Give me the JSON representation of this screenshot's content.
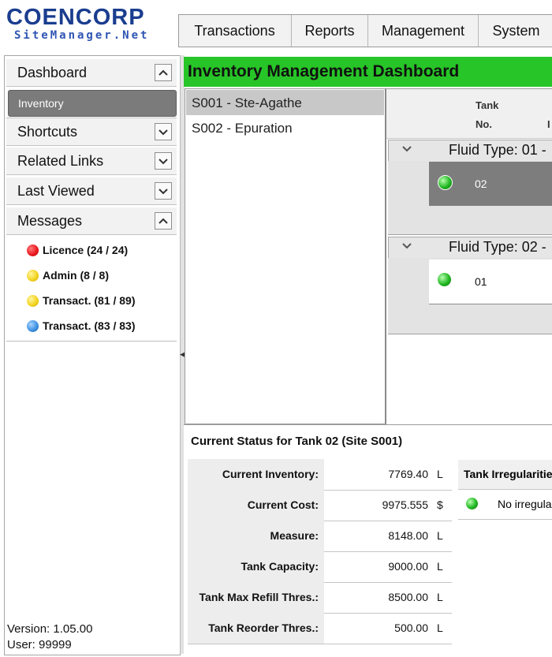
{
  "logo": {
    "line1": "COENCORP",
    "line2": "SiteManager.Net"
  },
  "menu": [
    "Transactions",
    "Reports",
    "Management",
    "System"
  ],
  "sidebar": {
    "dashboard": "Dashboard",
    "inventory": "Inventory",
    "shortcuts": "Shortcuts",
    "related_links": "Related Links",
    "last_viewed": "Last Viewed",
    "messages": "Messages",
    "message_items": [
      {
        "label": "Licence (24 / 24)",
        "color": "#e8141a"
      },
      {
        "label": "Admin (8 / 8)",
        "color": "#f2d21a"
      },
      {
        "label": "Transact. (81 / 89)",
        "color": "#f2d21a"
      },
      {
        "label": "Transact. (83 / 83)",
        "color": "#3a8ee0"
      }
    ],
    "version": "Version: 1.05.00",
    "user": "User: 99999"
  },
  "main": {
    "title": "Inventory Management Dashboard",
    "title_bg": "#27c527",
    "sites": [
      "S001 - Ste-Agathe",
      "S002 - Epuration"
    ],
    "grid_header": {
      "tank": "Tank",
      "no": "No.",
      "extra": "I"
    },
    "groups": [
      {
        "title": "Fluid Type: 01 -",
        "tank": "02",
        "status_color": "#22b822"
      },
      {
        "title": "Fluid Type: 02 -",
        "tank": "01",
        "status_color": "#22b822"
      }
    ]
  },
  "status": {
    "title": "Current Status for Tank 02 (Site S001)",
    "rows": [
      {
        "label": "Current Inventory:",
        "value": "7769.40",
        "unit": "L"
      },
      {
        "label": "Current Cost:",
        "value": "9975.555",
        "unit": "$"
      },
      {
        "label": "Measure:",
        "value": "8148.00",
        "unit": "L"
      },
      {
        "label": "Tank Capacity:",
        "value": "9000.00",
        "unit": "L"
      },
      {
        "label": "Tank Max Refill Thres.:",
        "value": "8500.00",
        "unit": "L"
      },
      {
        "label": "Tank Reorder Thres.:",
        "value": "500.00",
        "unit": "L"
      }
    ],
    "irregularities_header": "Tank Irregularities",
    "irregularities_row": "No irregularities"
  }
}
